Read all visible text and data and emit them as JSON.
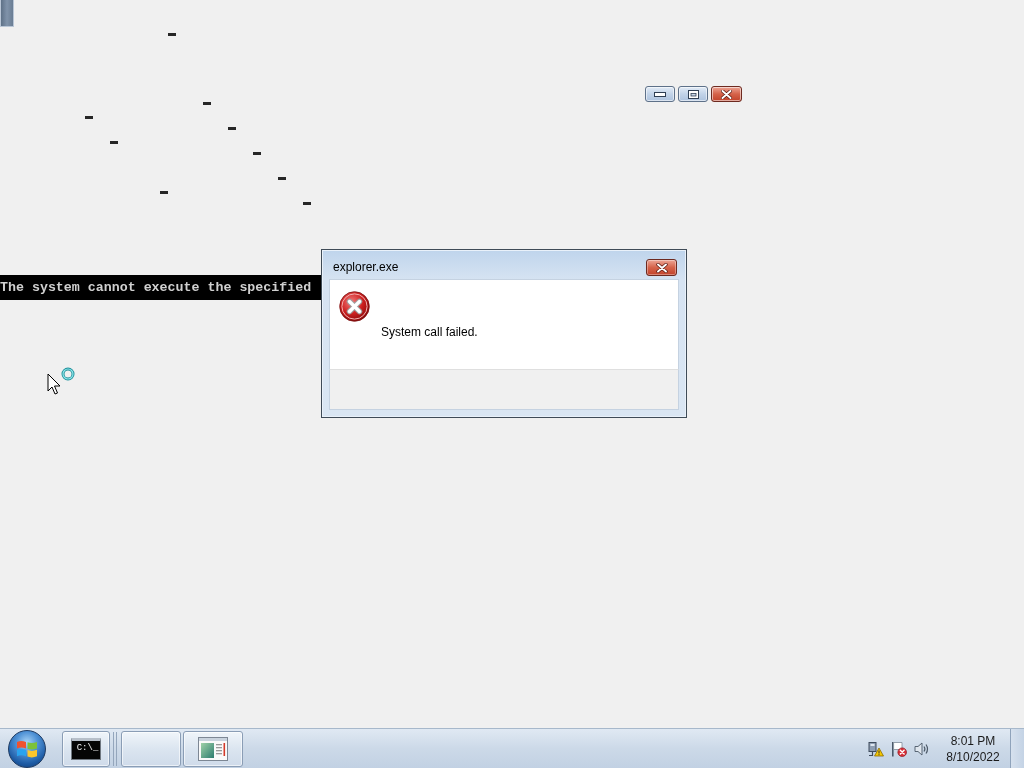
{
  "desktop": {
    "console_line": "The system cannot execute the specified"
  },
  "caption_buttons": [
    {
      "kind": "minimize"
    },
    {
      "kind": "maximize"
    },
    {
      "kind": "close"
    }
  ],
  "dialog": {
    "title": "explorer.exe",
    "message": "System call failed."
  },
  "taskbar": {
    "buttons": [
      {
        "kind": "console",
        "icon_text": "C:\\_"
      },
      {
        "kind": "blank"
      },
      {
        "kind": "document"
      }
    ],
    "tray_icons": [
      {
        "kind": "network"
      },
      {
        "kind": "flag"
      },
      {
        "kind": "speaker"
      }
    ],
    "clock": {
      "time": "8:01 PM",
      "date": "8/10/2022"
    }
  }
}
